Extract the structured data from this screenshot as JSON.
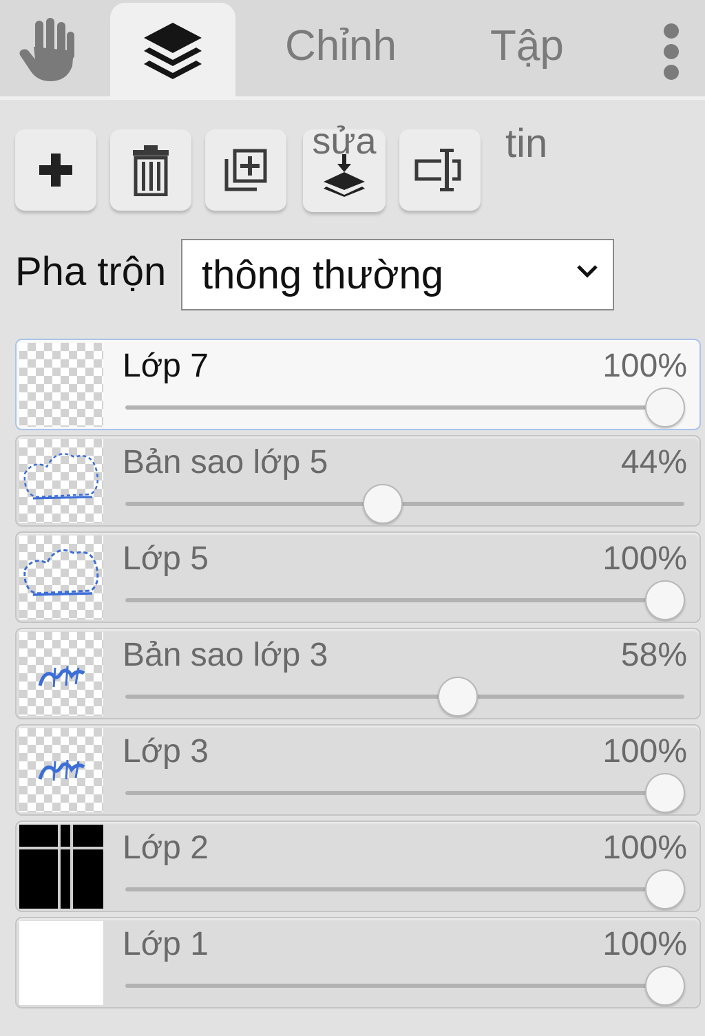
{
  "tabs": {
    "hand_icon": "hand-icon",
    "layers_icon": "layers-icon",
    "chinh_label": "Chỉnh",
    "tap_label": "Tập",
    "more_icon": "more-vertical-icon"
  },
  "toolbar": {
    "add_icon": "plus-icon",
    "delete_icon": "trash-icon",
    "duplicate_icon": "duplicate-icon",
    "merge_label": "sửa",
    "merge_icon": "merge-down-icon",
    "rename_icon": "rename-icon",
    "info_label": "tin"
  },
  "blend": {
    "label": "Pha trộn",
    "value": "thông thường"
  },
  "colors": {
    "active_border": "#aac4ec",
    "thumb_stroke": "#3c6ed8",
    "panel_bg": "#e2e2e2"
  },
  "layers": [
    {
      "name": "Lớp 7",
      "opacity_label": "100%",
      "opacity": 1.0,
      "active": true
    },
    {
      "name": "Bản sao lớp 5",
      "opacity_label": "44%",
      "opacity": 0.44,
      "active": false
    },
    {
      "name": "Lớp 5",
      "opacity_label": "100%",
      "opacity": 1.0,
      "active": false
    },
    {
      "name": "Bản sao lớp 3",
      "opacity_label": "58%",
      "opacity": 0.58,
      "active": false
    },
    {
      "name": "Lớp 3",
      "opacity_label": "100%",
      "opacity": 1.0,
      "active": false
    },
    {
      "name": "Lớp 2",
      "opacity_label": "100%",
      "opacity": 1.0,
      "active": false
    },
    {
      "name": "Lớp 1",
      "opacity_label": "100%",
      "opacity": 1.0,
      "active": false
    }
  ]
}
